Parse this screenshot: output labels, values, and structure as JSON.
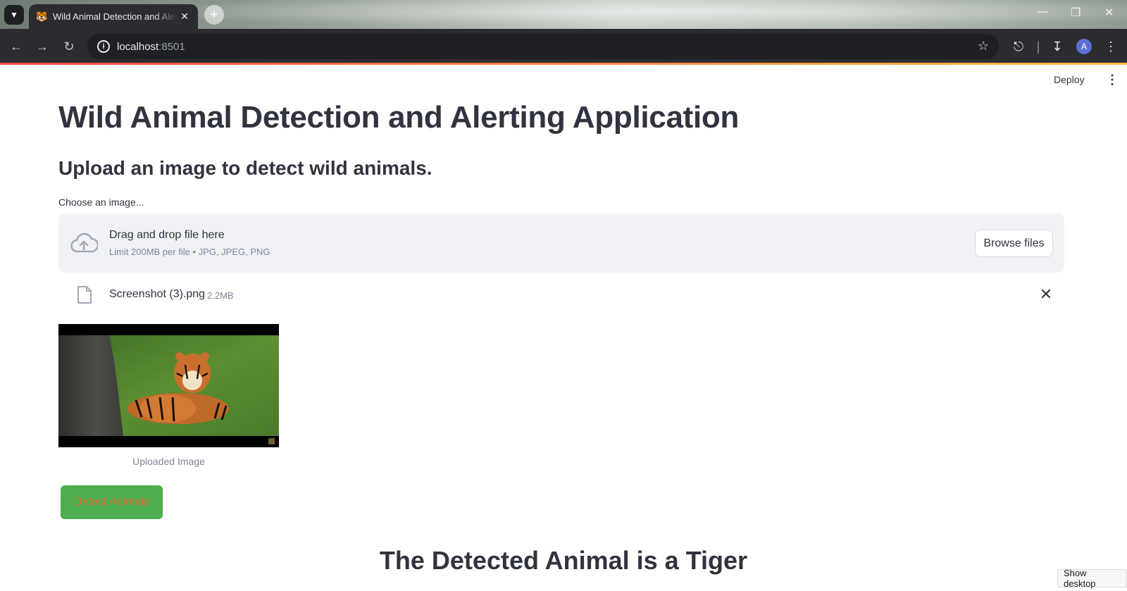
{
  "browser": {
    "tab_title": "Wild Animal Detection and Alerting Application",
    "tab_favicon": "tiger-emoji",
    "url_host": "localhost",
    "url_port": ":8501",
    "profile_initial": "A"
  },
  "app_header": {
    "deploy_label": "Deploy"
  },
  "main": {
    "title": "Wild Animal Detection and Alerting Application",
    "subtitle": "Upload an image to detect wild animals.",
    "uploader": {
      "label": "Choose an image...",
      "drop_title": "Drag and drop file here",
      "drop_hint": "Limit 200MB per file • JPG, JPEG, PNG",
      "browse_label": "Browse files"
    },
    "uploaded_file": {
      "name": "Screenshot (3).png",
      "size": "2.2MB"
    },
    "image_caption": "Uploaded Image",
    "detect_button_label": "Detect Animals",
    "result_text": "The Detected Animal is a Tiger"
  },
  "taskbar": {
    "show_desktop_label": "Show desktop"
  },
  "colors": {
    "detect_button_bg": "#4cae4f",
    "detect_button_text": "#e36b36",
    "text_primary": "#31333f",
    "dropzone_bg": "#f0f2f6"
  }
}
